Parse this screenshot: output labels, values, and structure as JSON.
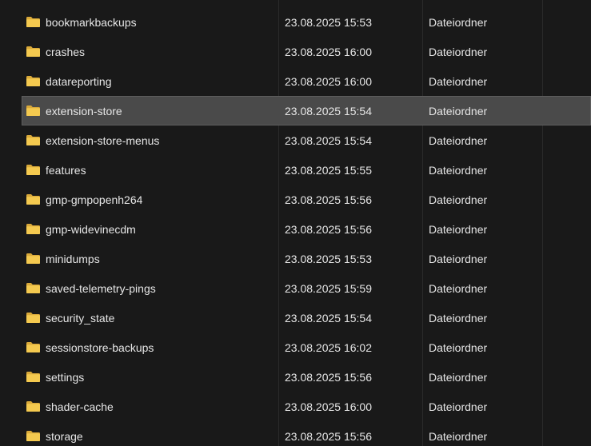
{
  "folders": [
    {
      "name": "bookmarkbackups",
      "date": "23.08.2025 15:53",
      "type": "Dateiordner",
      "icon": "folder-icon"
    },
    {
      "name": "crashes",
      "date": "23.08.2025 16:00",
      "type": "Dateiordner",
      "icon": "folder-icon"
    },
    {
      "name": "datareporting",
      "date": "23.08.2025 16:00",
      "type": "Dateiordner",
      "icon": "folder-icon"
    },
    {
      "name": "extension-store",
      "date": "23.08.2025 15:54",
      "type": "Dateiordner",
      "icon": "folder-icon",
      "selected": true
    },
    {
      "name": "extension-store-menus",
      "date": "23.08.2025 15:54",
      "type": "Dateiordner",
      "icon": "folder-icon"
    },
    {
      "name": "features",
      "date": "23.08.2025 15:55",
      "type": "Dateiordner",
      "icon": "folder-icon"
    },
    {
      "name": "gmp-gmpopenh264",
      "date": "23.08.2025 15:56",
      "type": "Dateiordner",
      "icon": "folder-icon"
    },
    {
      "name": "gmp-widevinecdm",
      "date": "23.08.2025 15:56",
      "type": "Dateiordner",
      "icon": "folder-icon"
    },
    {
      "name": "minidumps",
      "date": "23.08.2025 15:53",
      "type": "Dateiordner",
      "icon": "folder-icon"
    },
    {
      "name": "saved-telemetry-pings",
      "date": "23.08.2025 15:59",
      "type": "Dateiordner",
      "icon": "folder-icon"
    },
    {
      "name": "security_state",
      "date": "23.08.2025 15:54",
      "type": "Dateiordner",
      "icon": "folder-icon"
    },
    {
      "name": "sessionstore-backups",
      "date": "23.08.2025 16:02",
      "type": "Dateiordner",
      "icon": "folder-icon"
    },
    {
      "name": "settings",
      "date": "23.08.2025 15:56",
      "type": "Dateiordner",
      "icon": "folder-icon"
    },
    {
      "name": "shader-cache",
      "date": "23.08.2025 16:00",
      "type": "Dateiordner",
      "icon": "folder-icon"
    },
    {
      "name": "storage",
      "date": "23.08.2025 15:56",
      "type": "Dateiordner",
      "icon": "folder-icon"
    }
  ],
  "colors": {
    "background": "#191919",
    "text": "#e6e6e6",
    "selection": "#4a4a4a",
    "folder": "#f4c94f"
  }
}
